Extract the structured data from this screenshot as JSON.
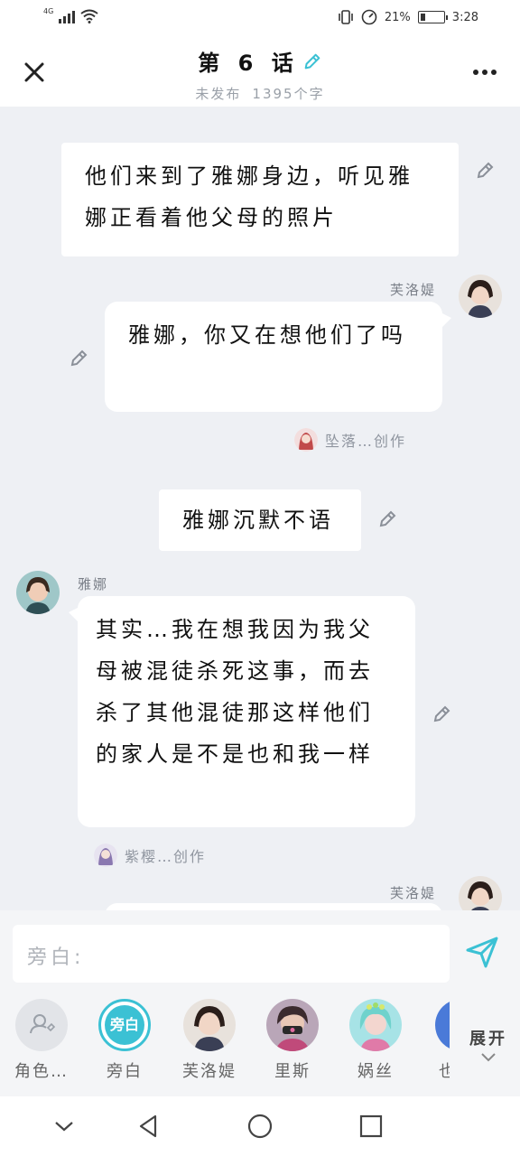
{
  "status_bar": {
    "network": "4G",
    "battery_pct": "21%",
    "battery_level": 0.21,
    "time": "3:28"
  },
  "header": {
    "title": "第 6 话",
    "status": "未发布",
    "word_count": "1395个字"
  },
  "messages": {
    "narration1": {
      "text": "他们来到了雅娜身边，听见雅娜正看着他父母的照片"
    },
    "msg1": {
      "speaker": "芙洛媞",
      "text": "雅娜，你又在想他们了吗",
      "credit": "坠落…创作"
    },
    "narration2": {
      "text": "雅娜沉默不语"
    },
    "msg2": {
      "speaker": "雅娜",
      "text": "其实…我在想我因为我父母被混徒杀死这事，而去杀了其他混徒那这样他们的家人是不是也和我一样",
      "credit": "紫樱…创作"
    },
    "msg3": {
      "speaker": "芙洛媞"
    }
  },
  "composer": {
    "placeholder": "旁白:"
  },
  "roles": [
    {
      "label": "角色…"
    },
    {
      "label": "旁白",
      "icon_text": "旁白"
    },
    {
      "label": "芙洛媞"
    },
    {
      "label": "里斯"
    },
    {
      "label": "娲丝"
    },
    {
      "label": "也"
    }
  ],
  "expand_label": "展开",
  "colors": {
    "accent": "#3bc1d4",
    "chat_bg": "#eef0f4",
    "bubble": "#ffffff"
  }
}
